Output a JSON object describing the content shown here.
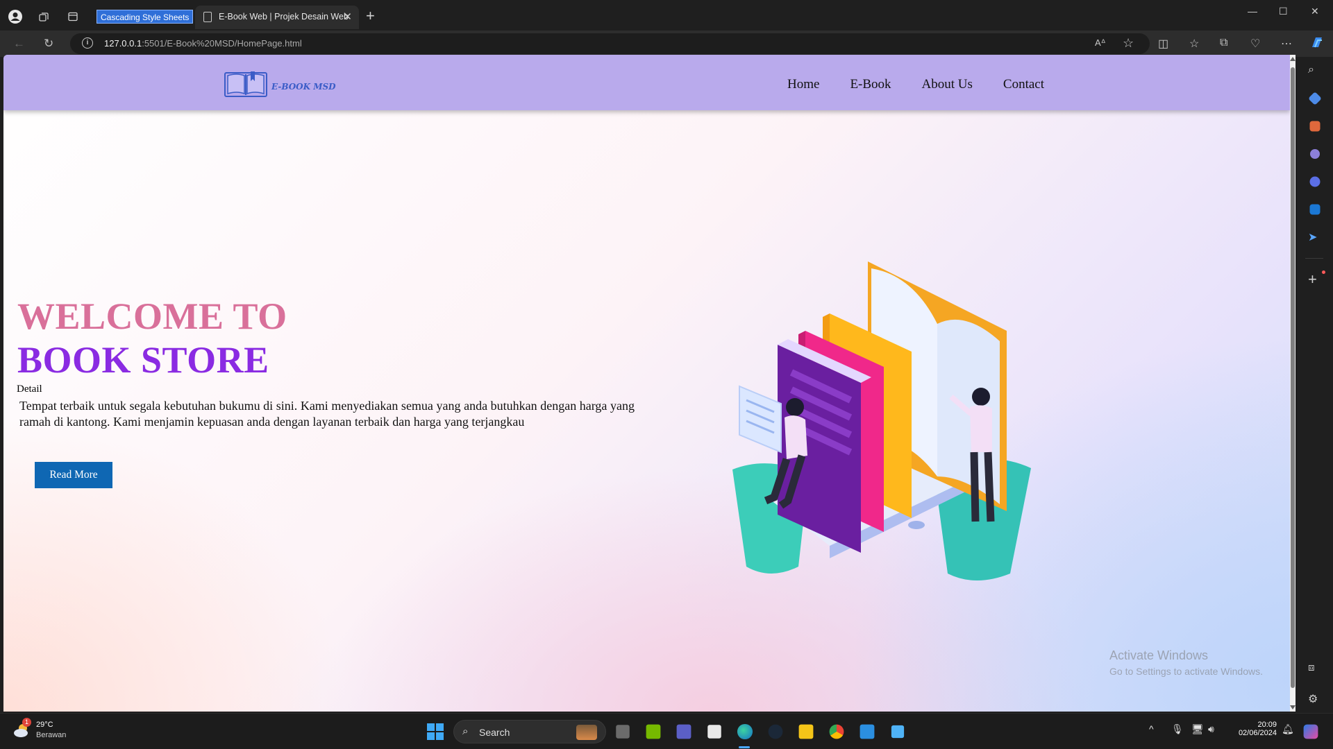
{
  "browser": {
    "selected_text": "Cascading Style Sheets",
    "tab_title": "E-Book Web | Projek Desain Web",
    "url_host": "127.0.0.1",
    "url_rest": ":5501/E-Book%20MSD/HomePage.html"
  },
  "site": {
    "logo_text": "E-BOOK MSD",
    "nav": [
      "Home",
      "E-Book",
      "About Us",
      "Contact"
    ],
    "hero": {
      "title_line1": "WELCOME TO",
      "title_line2": "BOOK STORE",
      "detail_label": "Detail",
      "description": "Tempat terbaik untuk segala kebutuhan bukumu di sini. Kami menyediakan semua yang anda butuhkan dengan harga yang ramah di kantong. Kami menjamin kepuasan anda dengan layanan terbaik dan harga yang terjangkau",
      "button": "Read More"
    },
    "colors": {
      "header": "#b9aaec",
      "title_line1": "#d9709a",
      "title_line2": "#8a2be2",
      "button": "#0f67b3"
    }
  },
  "watermark": {
    "title": "Activate Windows",
    "subtitle": "Go to Settings to activate Windows."
  },
  "taskbar": {
    "weather_temp": "29°C",
    "weather_cond": "Berawan",
    "weather_badge": "1",
    "search_label": "Search",
    "time": "20:09",
    "date": "02/06/2024"
  }
}
